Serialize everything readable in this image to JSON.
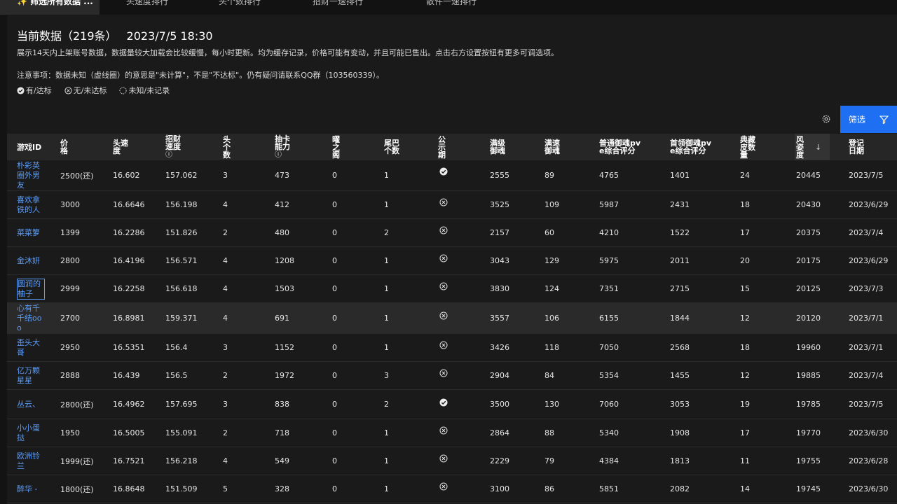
{
  "tabs": [
    {
      "label": "筛选所有数据 ...",
      "active": true
    },
    {
      "label": "头速度排行",
      "active": false
    },
    {
      "label": "头个数排行",
      "active": false
    },
    {
      "label": "招财一速排行",
      "active": false
    },
    {
      "label": "散件一速排行",
      "active": false
    }
  ],
  "header": {
    "title": "当前数据（219条）",
    "datetime": "2023/7/5 18:30",
    "desc": "展示14天内上架账号数据，数据量较大加载会比较缓慢，每小时更新。均为缓存记录，价格可能有变动，并且可能已售出。点击右方设置按钮有更多可调选项。",
    "note": "注意事项：数据未知（虚线圈）的意思是\"未计算\"，不是\"不达标\"。仍有疑问请联系QQ群（103560339）。",
    "legend": [
      "有/达标",
      "无/未达标",
      "未知/未记录"
    ]
  },
  "toolbar": {
    "filter_label": "筛选"
  },
  "columns": [
    {
      "label": "游戏ID"
    },
    {
      "label": "价格"
    },
    {
      "label": "头速度"
    },
    {
      "label": "招财速度",
      "info": true
    },
    {
      "label": "头个数"
    },
    {
      "label": "抽卡能力",
      "info": true
    },
    {
      "label": "曜之阁"
    },
    {
      "label": "尾巴个数"
    },
    {
      "label": "公示期"
    },
    {
      "label": "满级御魂"
    },
    {
      "label": "满速御魂"
    },
    {
      "label": "普通御魂pve综合评分"
    },
    {
      "label": "首领御魂pve综合评分"
    },
    {
      "label": "典藏皮数量"
    },
    {
      "label": "风姿度"
    },
    {
      "label": "登记日期"
    }
  ],
  "rows": [
    {
      "name": "朴彩英圈外男友",
      "price": "2500(还)",
      "speed": "16.602",
      "zc": "157.062",
      "heads": "3",
      "draw": "473",
      "yao": "0",
      "tail": "1",
      "pub": "yes",
      "full": "2555",
      "fspeed": "89",
      "pve": "4765",
      "boss": "1401",
      "skin": "24",
      "fz": "20445",
      "date": "2023/7/5"
    },
    {
      "name": "喜欢拿铁的人",
      "price": "3000",
      "speed": "16.6646",
      "zc": "156.198",
      "heads": "4",
      "draw": "412",
      "yao": "0",
      "tail": "1",
      "pub": "no",
      "full": "3525",
      "fspeed": "109",
      "pve": "5987",
      "boss": "2431",
      "skin": "18",
      "fz": "20430",
      "date": "2023/6/29"
    },
    {
      "name": "菜菜箩",
      "price": "1399",
      "speed": "16.2286",
      "zc": "151.826",
      "heads": "2",
      "draw": "480",
      "yao": "0",
      "tail": "2",
      "pub": "no",
      "full": "2157",
      "fspeed": "60",
      "pve": "4210",
      "boss": "1522",
      "skin": "17",
      "fz": "20375",
      "date": "2023/7/4"
    },
    {
      "name": "金沐妍",
      "price": "2800",
      "speed": "16.4196",
      "zc": "156.571",
      "heads": "4",
      "draw": "1208",
      "yao": "0",
      "tail": "1",
      "pub": "no",
      "full": "3043",
      "fspeed": "129",
      "pve": "5975",
      "boss": "2011",
      "skin": "20",
      "fz": "20175",
      "date": "2023/6/29"
    },
    {
      "name": "圆润的柚子",
      "price": "2999",
      "speed": "16.2258",
      "zc": "156.618",
      "heads": "4",
      "draw": "1503",
      "yao": "0",
      "tail": "1",
      "pub": "no",
      "full": "3830",
      "fspeed": "124",
      "pve": "7351",
      "boss": "2715",
      "skin": "15",
      "fz": "20125",
      "date": "2023/7/3"
    },
    {
      "name": "心有千千结ooo",
      "price": "2700",
      "speed": "16.8981",
      "zc": "159.371",
      "heads": "4",
      "draw": "691",
      "yao": "0",
      "tail": "1",
      "pub": "no",
      "full": "3557",
      "fspeed": "106",
      "pve": "6155",
      "boss": "1844",
      "skin": "12",
      "fz": "20120",
      "date": "2023/7/1"
    },
    {
      "name": "歪头大哥",
      "price": "2950",
      "speed": "16.5351",
      "zc": "156.4",
      "heads": "3",
      "draw": "1152",
      "yao": "0",
      "tail": "1",
      "pub": "no",
      "full": "3426",
      "fspeed": "118",
      "pve": "7050",
      "boss": "2568",
      "skin": "18",
      "fz": "19960",
      "date": "2023/7/1"
    },
    {
      "name": "亿万颗星星",
      "price": "2888",
      "speed": "16.439",
      "zc": "156.5",
      "heads": "2",
      "draw": "1972",
      "yao": "0",
      "tail": "3",
      "pub": "no",
      "full": "2904",
      "fspeed": "84",
      "pve": "5354",
      "boss": "1455",
      "skin": "12",
      "fz": "19885",
      "date": "2023/7/4"
    },
    {
      "name": "丛云、",
      "price": "2800(还)",
      "speed": "16.4962",
      "zc": "157.695",
      "heads": "3",
      "draw": "838",
      "yao": "0",
      "tail": "2",
      "pub": "yes",
      "full": "3500",
      "fspeed": "130",
      "pve": "7060",
      "boss": "3053",
      "skin": "19",
      "fz": "19785",
      "date": "2023/7/5"
    },
    {
      "name": "小小蛋挞",
      "price": "1950",
      "speed": "16.5005",
      "zc": "155.091",
      "heads": "2",
      "draw": "718",
      "yao": "0",
      "tail": "1",
      "pub": "no",
      "full": "2864",
      "fspeed": "88",
      "pve": "5340",
      "boss": "1908",
      "skin": "17",
      "fz": "19770",
      "date": "2023/6/30"
    },
    {
      "name": "欧洲铃兰",
      "price": "1999(还)",
      "speed": "16.7521",
      "zc": "156.218",
      "heads": "4",
      "draw": "549",
      "yao": "0",
      "tail": "1",
      "pub": "no",
      "full": "2229",
      "fspeed": "79",
      "pve": "4384",
      "boss": "1813",
      "skin": "11",
      "fz": "19755",
      "date": "2023/6/28"
    },
    {
      "name": "醉华 -",
      "price": "1800(还)",
      "speed": "16.8648",
      "zc": "151.509",
      "heads": "5",
      "draw": "328",
      "yao": "0",
      "tail": "1",
      "pub": "no",
      "full": "3100",
      "fspeed": "86",
      "pve": "5851",
      "boss": "2082",
      "skin": "14",
      "fz": "19745",
      "date": "2023/6/30"
    }
  ],
  "colors": {
    "link": "#5b9cf8",
    "primary": "#1e6ff2"
  }
}
